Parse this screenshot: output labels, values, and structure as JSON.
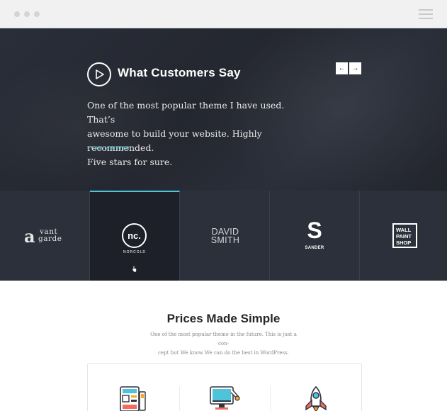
{
  "window": {
    "traffic_dots": [
      "dot",
      "dot",
      "dot"
    ],
    "menu_icon": "hamburger-icon"
  },
  "hero": {
    "title": "What Customers Say",
    "play_icon": "play-icon",
    "prev_icon": "arrow-left-icon",
    "next_icon": "arrow-right-icon",
    "prev_glyph": "←",
    "next_glyph": "→",
    "quote_line1": "One of the most popular theme I have used. That’s",
    "quote_line2": "awesome to build your website. Highly recommended.",
    "quote_line3": "Five stars for sure.",
    "author": "-   SAM ISBISTER"
  },
  "logos": {
    "active_index": 1,
    "vant_a": "a",
    "vant_line1": "vant",
    "vant_line2": "garde",
    "nc_mark": "nc.",
    "nc_label": "NORCOLD",
    "david_line1": "DAVID",
    "david_line2": "SMITH",
    "sander_mark": "S",
    "sander_label": "SANDER",
    "wall_line1": "WALL",
    "wall_line2": "PAINT",
    "wall_line3": "SHOP"
  },
  "pricing": {
    "title": "Prices Made Simple",
    "subtitle_line1": "One of the most popular theme in the future. This is just a con-",
    "subtitle_line2": "cept but We know We can do the best in WordPress.",
    "icons": [
      "layout-icon",
      "monitor-icon",
      "rocket-icon"
    ]
  },
  "colors": {
    "accent": "#4fc3d9",
    "hero_bg": "#262a33",
    "logo_strip_bg": "#2c303a",
    "logo_active_bg": "#1d2029"
  }
}
